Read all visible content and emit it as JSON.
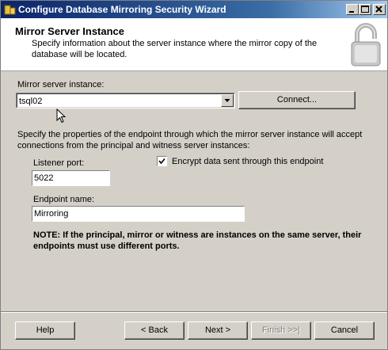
{
  "window": {
    "title": "Configure Database Mirroring Security Wizard"
  },
  "header": {
    "title": "Mirror Server Instance",
    "description": "Specify information about the server instance where the mirror copy of the database will be located."
  },
  "mirror_instance": {
    "label": "Mirror server instance:",
    "value": "tsql02",
    "connect_label": "Connect..."
  },
  "endpoint": {
    "instructions": "Specify the properties of the endpoint through which the mirror server instance will accept connections from the principal and witness server instances:",
    "listener_port_label": "Listener port:",
    "listener_port_value": "5022",
    "encrypt_label": "Encrypt data sent through this endpoint",
    "encrypt_checked": true,
    "endpoint_name_label": "Endpoint name:",
    "endpoint_name_value": "Mirroring",
    "note": "NOTE: If the principal, mirror or witness are instances on the same server, their endpoints must use different ports."
  },
  "footer": {
    "help": "Help",
    "back": "< Back",
    "next": "Next >",
    "finish": "Finish >>|",
    "cancel": "Cancel"
  },
  "icons": [
    "app-icon",
    "minimize-icon",
    "maximize-icon",
    "close-icon",
    "lock-icon",
    "dropdown-arrow-icon",
    "checkmark-icon",
    "mouse-cursor-icon"
  ]
}
